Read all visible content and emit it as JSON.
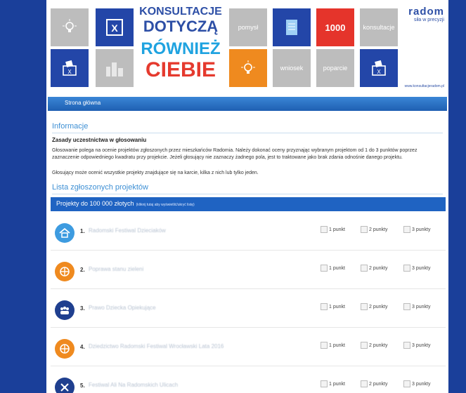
{
  "banner": {
    "brand_lines": [
      "KONSULTACJE",
      "DOTYCZĄ",
      "RÓWNIEŻ",
      "CIEBIE"
    ],
    "tiles": {
      "pomysl": "pomysł",
      "count": "1000",
      "konsultacje": "konsultacje",
      "wniosek": "wniosek",
      "poparcie": "poparcie"
    },
    "logo_name": "radom",
    "logo_slogan": "siła w precyzji",
    "site": "www.konsultacjeradom.pl"
  },
  "nav": {
    "home": "Strona główna"
  },
  "info": {
    "title": "Informacje",
    "rules_heading": "Zasady uczestnictwa w głosowaniu",
    "paragraph1": "Głosowanie polega na ocenie projektów zgłoszonych przez mieszkańców Radomia. Należy dokonać oceny przyznając wybranym projektom od 1 do 3 punktów poprzez zaznaczenie odpowiedniego kwadratu przy projekcie. Jeżeli głosujący nie zaznaczy żadnego pola, jest to traktowane jako brak zdania odnośnie danego projektu.",
    "paragraph2": "Głosujący może ocenić wszystkie projekty znajdujące się na karcie, kilka z nich lub tylko jeden."
  },
  "list": {
    "title": "Lista zgłoszonych projektów",
    "category": "Projekty do 100 000 złotych",
    "category_hint": "(kliknij tutaj aby wyświetlić/ukryć listę)",
    "options": [
      "1 punkt",
      "2 punkty",
      "3 punkty"
    ],
    "projects": [
      {
        "num": "1.",
        "name": "Radomski Festiwal Dzieciaków",
        "icon": "home-icon",
        "color": "#3d9be0"
      },
      {
        "num": "2.",
        "name": "Poprawa stanu zieleni",
        "icon": "globe-icon",
        "color": "#ef8a1f"
      },
      {
        "num": "3.",
        "name": "Prawo Dziecka Opiekujące",
        "icon": "people-icon",
        "color": "#1f3f8f"
      },
      {
        "num": "4.",
        "name": "Dziedzictwo Radomski Festiwal Wrocławski Lata 2016",
        "icon": "globe-icon",
        "color": "#ef8a1f"
      },
      {
        "num": "5.",
        "name": "Festiwal Ali Na Radomskich Ulicach",
        "icon": "tools-icon",
        "color": "#1f3f8f"
      }
    ]
  }
}
